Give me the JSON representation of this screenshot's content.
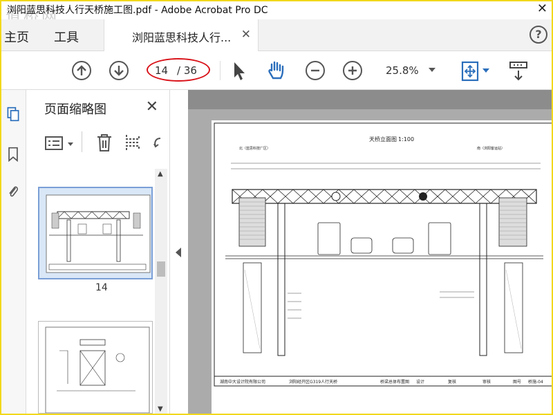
{
  "window": {
    "title": "浏阳蓝思科技人行天桥施工图.pdf - Adobe Acrobat Pro DC",
    "watermark": "道桥网"
  },
  "tabs": {
    "home": "主页",
    "tools": "工具",
    "document": "浏阳蓝思科技人行..."
  },
  "toolbar": {
    "current_page": "14",
    "total_pages": "/ 36",
    "zoom": "25.8%"
  },
  "panel": {
    "title": "页面缩略图",
    "thumbnails": [
      {
        "label": "14"
      }
    ]
  },
  "drawing": {
    "title": "天桥立面图",
    "scale": "1:100",
    "left_label": "北（蓝思科技厂区）",
    "right_label": "南（浏阳客运站）",
    "title_block": [
      "湖南中大设计院有限公司",
      "浏阳经开区G319人行天桥",
      "桥梁总体布置图",
      "设计",
      "复核",
      "审核",
      "图号",
      "桥施-04"
    ]
  },
  "colors": {
    "accent_red": "#d9131a",
    "acrobat_blue": "#2a6ebb",
    "frame_yellow": "#f2d81a"
  }
}
